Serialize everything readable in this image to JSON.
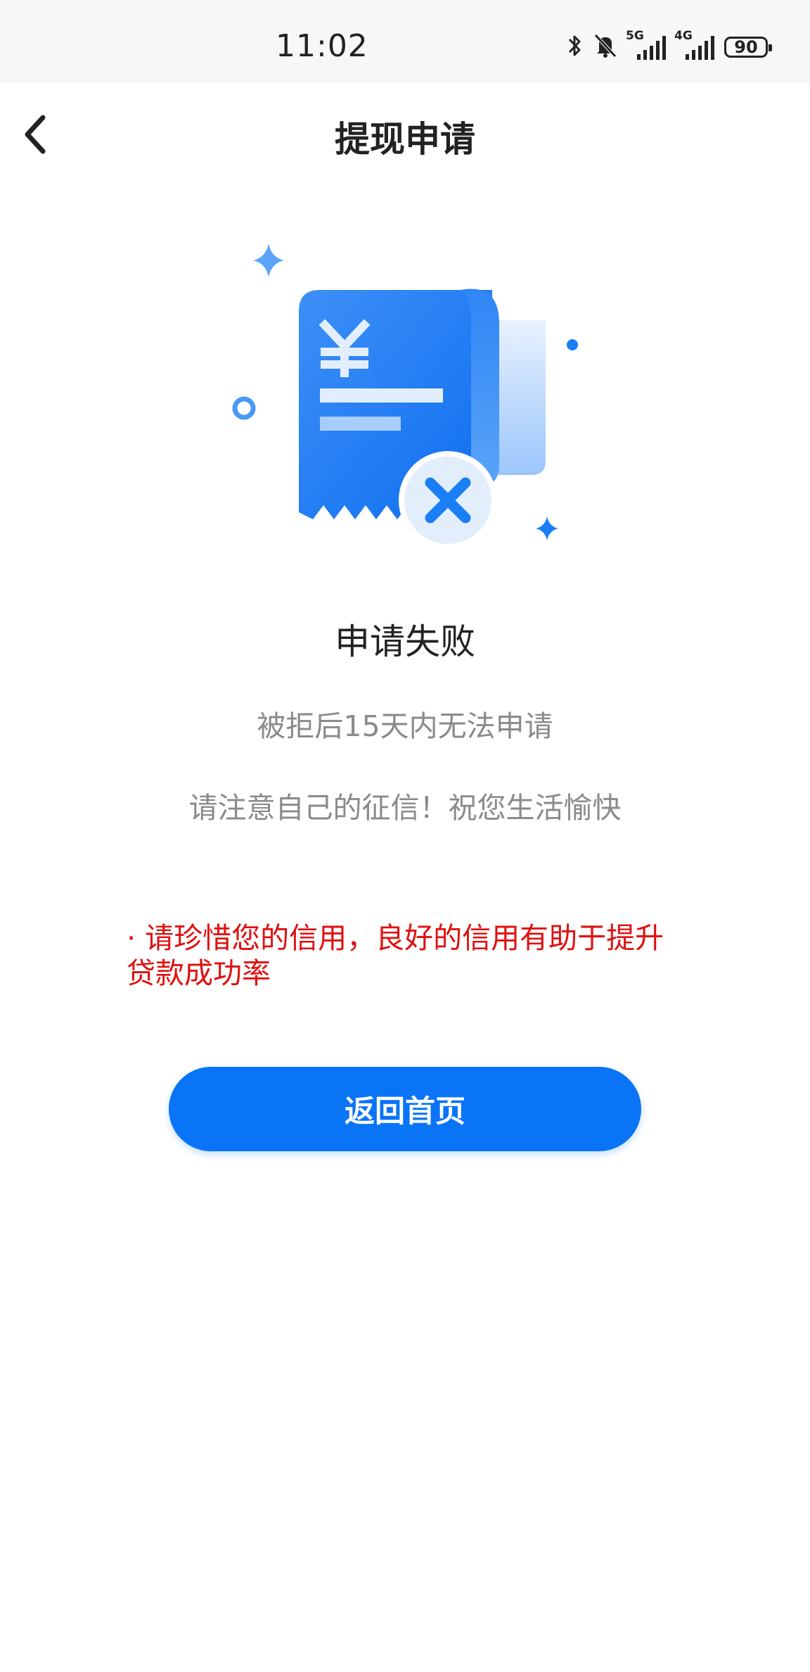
{
  "status_bar": {
    "time": "11:02",
    "network_1": "5G",
    "network_2": "4G",
    "battery": "90",
    "icons": [
      "bluetooth-icon",
      "bell-muted-icon",
      "signal-5g-icon",
      "signal-4g-icon",
      "battery-icon"
    ]
  },
  "nav": {
    "title": "提现申请",
    "back_icon": "chevron-left-icon"
  },
  "illustration": {
    "currency_symbol": "¥",
    "primary_color": "#1a7ef5",
    "light_color": "#cfe2fc"
  },
  "result": {
    "title": "申请失败",
    "message_1": "被拒后15天内无法申请",
    "message_2": "请注意自己的征信！祝您生活愉快",
    "tip": "· 请珍惜您的信用，良好的信用有助于提升贷款成功率"
  },
  "actions": {
    "home_button": "返回首页"
  },
  "colors": {
    "accent": "#0a74f6",
    "warning_text": "#e01010",
    "muted_text": "#8a8a8a"
  }
}
